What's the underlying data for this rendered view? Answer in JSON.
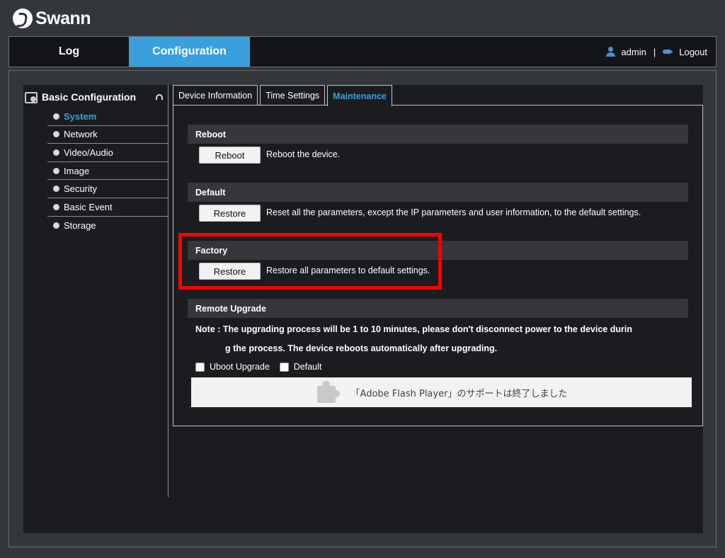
{
  "brand": {
    "name": "Swann"
  },
  "nav": {
    "log_tab": "Log",
    "config_tab": "Configuration",
    "user": "admin",
    "separator": "|",
    "logout": "Logout"
  },
  "sidebar": {
    "title": "Basic Configuration",
    "items": [
      {
        "label": "System",
        "active": true
      },
      {
        "label": "Network"
      },
      {
        "label": "Video/Audio"
      },
      {
        "label": "Image"
      },
      {
        "label": "Security"
      },
      {
        "label": "Basic Event"
      },
      {
        "label": "Storage"
      }
    ]
  },
  "tabs": [
    {
      "label": "Device Information"
    },
    {
      "label": "Time Settings"
    },
    {
      "label": "Maintenance",
      "active": true
    }
  ],
  "sections": {
    "reboot": {
      "title": "Reboot",
      "button": "Reboot",
      "description": "Reboot the device."
    },
    "default": {
      "title": "Default",
      "button": "Restore",
      "description": "Reset all the parameters, except the IP parameters and user information, to the default settings."
    },
    "factory": {
      "title": "Factory",
      "button": "Restore",
      "description": "Restore all parameters to default settings."
    },
    "remote_upgrade": {
      "title": "Remote Upgrade",
      "note_line1": "Note :  The upgrading process will be 1 to 10 minutes, please don't disconnect power to the device durin",
      "note_line2": "g the process. The device reboots automatically after upgrading.",
      "checkbox_uboot": "Uboot Upgrade",
      "checkbox_default": "Default",
      "plugin_message": "「Adobe Flash Player」のサポートは終了しました"
    }
  },
  "colors": {
    "accent": "#3aa0dd",
    "highlight": "#ff0000",
    "panel_bg": "#1b1c1f",
    "page_bg": "#33373c"
  }
}
